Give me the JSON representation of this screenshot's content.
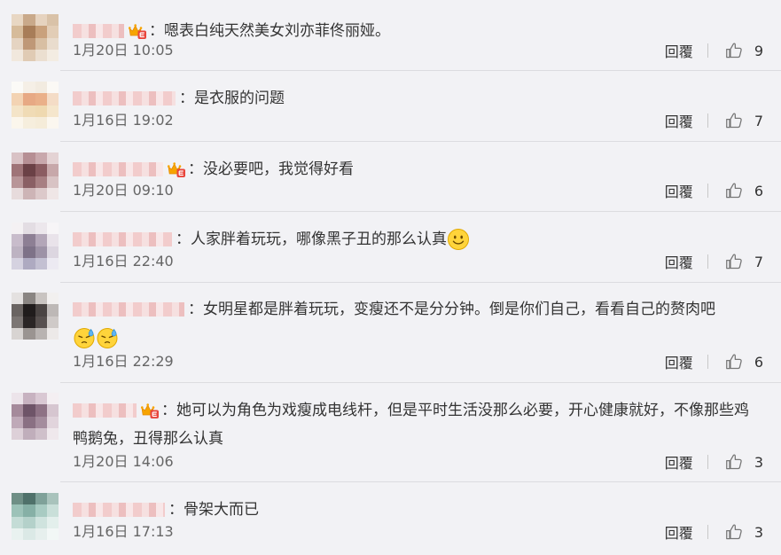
{
  "reply_label": "回覆",
  "comments": [
    {
      "username": "",
      "vip": true,
      "text": "：嗯表白纯天然美女刘亦菲佟丽娅。",
      "time": "1月20日 10:05",
      "likes": "9",
      "avatar": [
        "#e8d7c3",
        "#c9a98a",
        "#e6d3bf",
        "#d9c2a8",
        "#d6bb9a",
        "#a87d58",
        "#c9a17c",
        "#e2cdb6",
        "#e5d4c2",
        "#bf9877",
        "#d8bfa3",
        "#e9dccd",
        "#f1e8dd",
        "#e0cbb4",
        "#ebdfd0",
        "#f3ece2"
      ]
    },
    {
      "username": "",
      "vip": false,
      "text": "：是衣服的问题",
      "time": "1月16日 19:02",
      "likes": "7",
      "avatar": [
        "#fbfaf7",
        "#f5efe6",
        "#f2ebe0",
        "#fbf9f5",
        "#f3d3b3",
        "#e7a984",
        "#eab089",
        "#f4dcc6",
        "#f4e4c8",
        "#f0dbb5",
        "#efd9b0",
        "#f5e6cc",
        "#fbf6ec",
        "#f6eedd",
        "#f5ecd9",
        "#fbf7ef"
      ]
    },
    {
      "username": "",
      "vip": true,
      "text": "：没必要吧，我觉得好看",
      "time": "1月20日 09:10",
      "likes": "6",
      "avatar": [
        "#d9c2c5",
        "#b68f94",
        "#c8a8ac",
        "#e4d3d4",
        "#9f7478",
        "#6b4146",
        "#8b5d62",
        "#c7a8aa",
        "#b89598",
        "#8a5f64",
        "#a77f82",
        "#d8c3c4",
        "#e7dbdc",
        "#cdb4b6",
        "#dcc9ca",
        "#efe6e6"
      ]
    },
    {
      "username": "",
      "vip": false,
      "text": "：人家胖着玩玩，哪像黑子丑的那么认真",
      "emojis": [
        "smile"
      ],
      "time": "1月16日 22:40",
      "likes": "7",
      "avatar": [
        "#f4f1f3",
        "#e3dde3",
        "#ece7ec",
        "#f7f5f7",
        "#c8bccb",
        "#8d7f94",
        "#b3a6b8",
        "#e9e3ea",
        "#bdb3c2",
        "#7e7288",
        "#9d92a6",
        "#dcd6e0",
        "#d5d2e0",
        "#aeaac1",
        "#c3c0d2",
        "#eceaf2"
      ]
    },
    {
      "username": "",
      "vip": false,
      "text": "：女明星都是胖着玩玩，变瘦还不是分分钟。倒是你们自己，看看自己的赘肉吧",
      "emojis": [
        "sweat",
        "sweat"
      ],
      "time": "1月16日 22:29",
      "likes": "6",
      "avatar": [
        "#e4e1e0",
        "#8a8582",
        "#c9c4c1",
        "#f2f0ef",
        "#6a6462",
        "#201c1c",
        "#4a4443",
        "#bdb8b6",
        "#7c7674",
        "#2a2525",
        "#57504f",
        "#cfcac8",
        "#d8d4d2",
        "#9a9491",
        "#b8b3b1",
        "#ece9e8"
      ]
    },
    {
      "username": "",
      "vip": true,
      "text": "：她可以为角色为戏瘦成电线杆，但是平时生活没那么必要，开心健康就好，不像那些鸡鸭鹅兔，丑得那么认真",
      "time": "1月20日 14:06",
      "likes": "3",
      "avatar": [
        "#ece4ea",
        "#c7b2c0",
        "#d9c8d3",
        "#f4eff2",
        "#a58a9b",
        "#6e5468",
        "#8e7285",
        "#d6c6d0",
        "#bfa9b8",
        "#8a7083",
        "#a48c9d",
        "#e1d4dc",
        "#ddd0d8",
        "#c0aebb",
        "#cfc0ca",
        "#efe8ec"
      ]
    },
    {
      "username": "",
      "vip": false,
      "text": "：骨架大而已",
      "time": "1月16日 17:13",
      "likes": "3",
      "avatar": [
        "#6f8f86",
        "#4f716a",
        "#7fa199",
        "#a9c3bc",
        "#9cc2b8",
        "#86b0a6",
        "#a8cbc2",
        "#c9dfd9",
        "#c4dcd6",
        "#b4d1ca",
        "#cfe3de",
        "#e3efec",
        "#e9f2f0",
        "#dbe9e6",
        "#e6efed",
        "#f2f7f6"
      ]
    }
  ]
}
